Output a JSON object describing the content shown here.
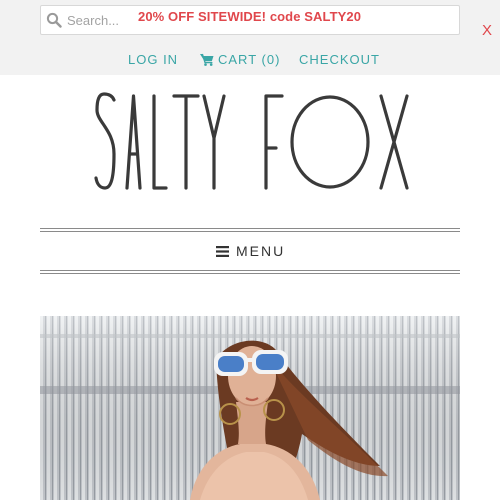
{
  "search": {
    "placeholder": "Search..."
  },
  "promo": {
    "text": "20% OFF SITEWIDE! code SALTY20"
  },
  "close_label": "X",
  "nav": {
    "login": "LOG IN",
    "cart": "CART (0)",
    "checkout": "CHECKOUT"
  },
  "brand": {
    "logo_text": "SALTY FOX"
  },
  "menu": {
    "label": "MENU"
  },
  "icons": [
    "search-icon",
    "cart-icon",
    "menu-icon",
    "close-icon"
  ],
  "colors": {
    "accent": "#3aa6a6",
    "promo": "#e0474c",
    "topbar": "#f2f2f2",
    "logo": "#3a3a3a"
  }
}
